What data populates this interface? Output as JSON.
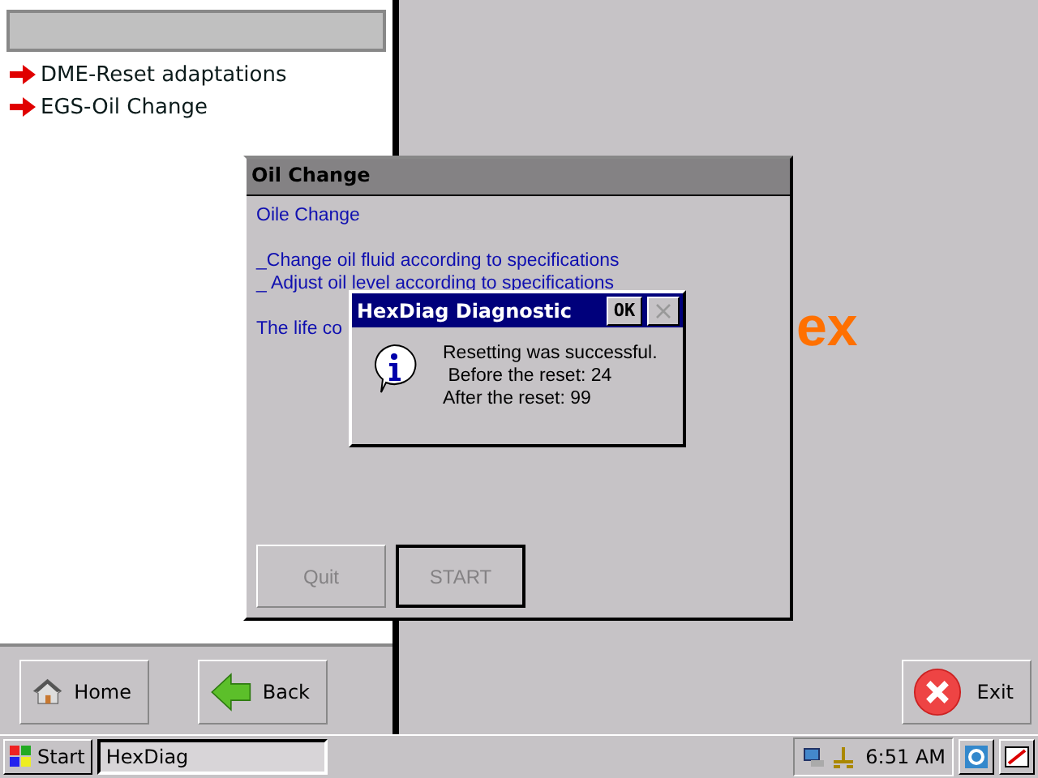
{
  "sidebar": {
    "items": [
      {
        "label": "DME-Reset adaptations"
      },
      {
        "label": "EGS-Oil Change"
      }
    ]
  },
  "logo": {
    "text": "ex"
  },
  "nav_buttons": [
    {
      "label": "Home",
      "kind": "home"
    },
    {
      "label": "Back",
      "kind": "back"
    }
  ],
  "exit_button": {
    "label": "Exit"
  },
  "oil_window": {
    "title": "Oil Change",
    "paragraphs": [
      [
        "Oile Change"
      ],
      [
        "_Change oil fluid according to specifications",
        "_ Adjust oil level according to specifications"
      ],
      [
        "The life co"
      ]
    ],
    "buttons": [
      {
        "label": "Quit",
        "focused": false
      },
      {
        "label": "START",
        "focused": true
      }
    ]
  },
  "dialog": {
    "title": "HexDiag Diagnostic",
    "ok": "OK",
    "message": [
      "Resetting was successful.",
      " Before the reset: 24",
      "After the reset: 99"
    ]
  },
  "taskbar": {
    "start": "Start",
    "task": "HexDiag",
    "time": "6:51 AM"
  }
}
